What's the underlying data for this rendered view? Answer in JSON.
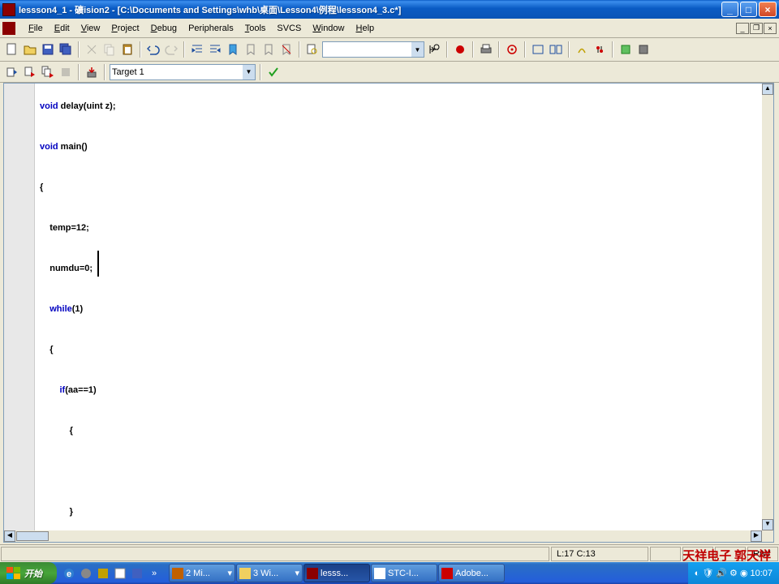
{
  "title": "lessson4_1  - 礦ision2 - [C:\\Documents and Settings\\whb\\桌面\\Lesson4\\例程\\lessson4_3.c*]",
  "menu": {
    "file": "File",
    "edit": "Edit",
    "view": "View",
    "project": "Project",
    "debug": "Debug",
    "peripherals": "Peripherals",
    "tools": "Tools",
    "svcs": "SVCS",
    "window": "Window",
    "help": "Help"
  },
  "target_combo": "Target 1",
  "find_combo": "",
  "code": {
    "l1_kw": "void",
    "l1_rest": " delay(uint z);",
    "l2_kw": "void",
    "l2_rest": " main()",
    "l3": "{",
    "l4": "    temp=12;",
    "l5": "    numdu=0;",
    "l6_pre": "    ",
    "l6_kw": "while",
    "l6_rest": "(1)",
    "l7": "    {",
    "l8_pre": "        ",
    "l8_kw": "if",
    "l8_rest": "(aa==1)",
    "l9": "            {",
    "l10": "",
    "l11": "            }",
    "l12": "    }"
  },
  "status": {
    "pos": "L:17 C:13",
    "mode": "R/W"
  },
  "start": "开始",
  "taskbar": [
    {
      "label": "2 Mi..."
    },
    {
      "label": "3 Wi..."
    },
    {
      "label": "lesss..."
    },
    {
      "label": "STC-I..."
    },
    {
      "label": "Adobe..."
    }
  ],
  "clock": "10:07",
  "watermark": "天祥电子  郭天祥"
}
